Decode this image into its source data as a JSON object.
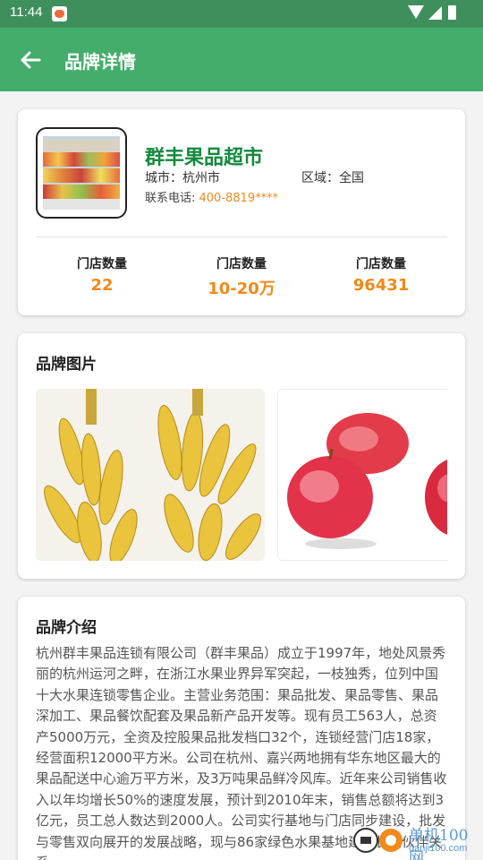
{
  "status_bar": {
    "time": "11:44"
  },
  "app_bar": {
    "title": "品牌详情"
  },
  "brand": {
    "name": "群丰果品超市",
    "city_label": "城市：",
    "city": "杭州市",
    "region_label": "区域：",
    "region": "全国",
    "phone_label": "联系电话: ",
    "phone": "400-8819****",
    "stats": [
      {
        "label": "门店数量",
        "value": "22"
      },
      {
        "label": "门店数量",
        "value": "10-20万"
      },
      {
        "label": "门店数量",
        "value": "96431"
      }
    ]
  },
  "images_section": {
    "title": "品牌图片"
  },
  "intro_section": {
    "title": "品牌介绍",
    "text": "杭州群丰果品连锁有限公司（群丰果品）成立于1997年，地处风景秀丽的杭州运河之畔，在浙江水果业界异军突起，一枝独秀，位列中国十大水果连锁零售企业。主营业务范围：果品批发、果品零售、果品深加工、果品餐饮配套及果品新产品开发等。现有员工563人，总资产5000万元，全资及控股果品批发档口32个，连锁经营门店18家，经营面积12000平方米。公司在杭州、嘉兴两地拥有华东地区最大的果品配送中心逾万平方米，及3万吨果品鲜冷风库。近年来公司销售收入以年均增长50%的速度发展，预计到2010年末，销售总额将达到3亿元，员工总人数达到2000人。公司实行基地与门店同步建设，批发与零售双向展开的发展战略，现与86家绿色水果基地建立长期伙伴关系"
  },
  "watermark": {
    "text": "单机100网",
    "url": "danji100.com"
  },
  "colors": {
    "primary": "#44ad6b",
    "status": "#3f8f5c",
    "accent": "#f08a19",
    "brand_name": "#138a3c"
  }
}
